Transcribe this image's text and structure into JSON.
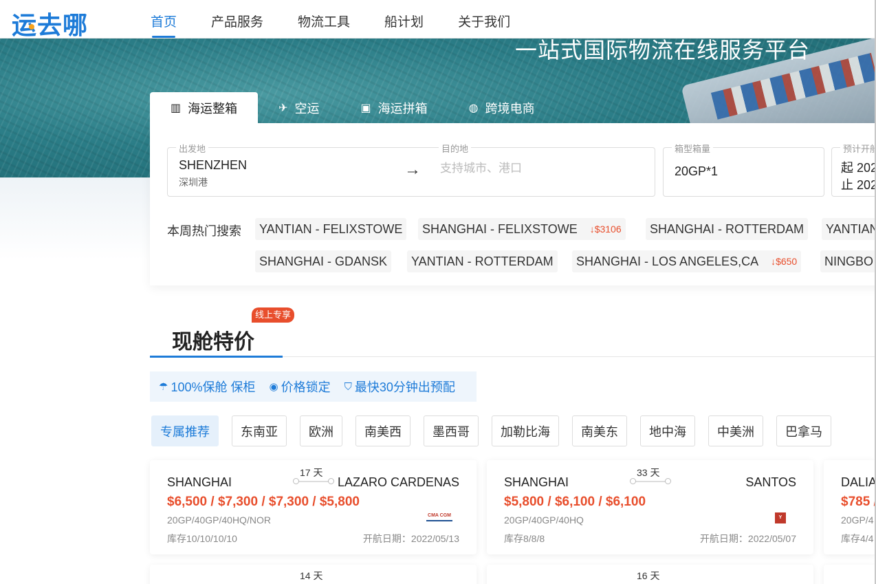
{
  "header": {
    "logo": "运去哪",
    "nav": [
      "首页",
      "产品服务",
      "物流工具",
      "船计划",
      "关于我们"
    ]
  },
  "hero": {
    "title": "一站式国际物流在线服务平台"
  },
  "search": {
    "tabs": [
      {
        "label": "海运整箱",
        "icon": "container-icon"
      },
      {
        "label": "空运",
        "icon": "plane-icon"
      },
      {
        "label": "海运拼箱",
        "icon": "boxes-icon"
      },
      {
        "label": "跨境电商",
        "icon": "globe-icon"
      }
    ],
    "origin_label": "出发地",
    "origin_value": "SHENZHEN",
    "origin_sub": "深圳港",
    "dest_label": "目的地",
    "dest_placeholder": "支持城市、港口",
    "box_label": "箱型箱量",
    "box_value": "20GP*1",
    "date_label": "预计开船",
    "date_start": "起 202",
    "date_end": "止 202",
    "hot_label": "本周热门搜索",
    "hot": [
      {
        "route": "YANTIAN - FELIXSTOWE",
        "drop": ""
      },
      {
        "route": "SHANGHAI - FELIXSTOWE",
        "drop": "$3106"
      },
      {
        "route": "SHANGHAI - ROTTERDAM",
        "drop": ""
      },
      {
        "route": "YANTIAN",
        "drop": ""
      },
      {
        "route": "SHANGHAI - GDANSK",
        "drop": ""
      },
      {
        "route": "YANTIAN - ROTTERDAM",
        "drop": ""
      },
      {
        "route": "SHANGHAI - LOS ANGELES,CA",
        "drop": "$650"
      },
      {
        "route": "NINGBO",
        "drop": ""
      }
    ]
  },
  "section": {
    "badge": "线上专享",
    "title": "现舱特价",
    "guarantees": [
      "100%保舱 保柜",
      "价格锁定",
      "最快30分钟出预配"
    ],
    "regions": [
      "专属推荐",
      "东南亚",
      "欧洲",
      "南美西",
      "墨西哥",
      "加勒比海",
      "南美东",
      "地中海",
      "中美洲",
      "巴拿马"
    ]
  },
  "cards": [
    {
      "from": "SHANGHAI",
      "to": "LAZARO CARDENAS",
      "days": "17 天",
      "price": "$6,500 / $7,300 / $7,300 / $5,800",
      "types": "20GP/40GP/40HQ/NOR",
      "stock": "库存10/10/10/10",
      "sail": "开航日期：2022/05/13",
      "carrier": "CMA CGM"
    },
    {
      "from": "SHANGHAI",
      "to": "SANTOS",
      "days": "33 天",
      "price": "$5,800 / $6,100 / $6,100",
      "types": "20GP/40GP/40HQ",
      "stock": "库存8/8/8",
      "sail": "开航日期：2022/05/07",
      "carrier": "Y"
    },
    {
      "from": "DALIA",
      "to": "",
      "days": "",
      "price": "$785 /",
      "types": "20GP/4",
      "stock": "库存4/4",
      "sail": "",
      "carrier": ""
    }
  ],
  "next_cards": [
    {
      "days": "14 天"
    },
    {
      "days": "16 天"
    }
  ]
}
